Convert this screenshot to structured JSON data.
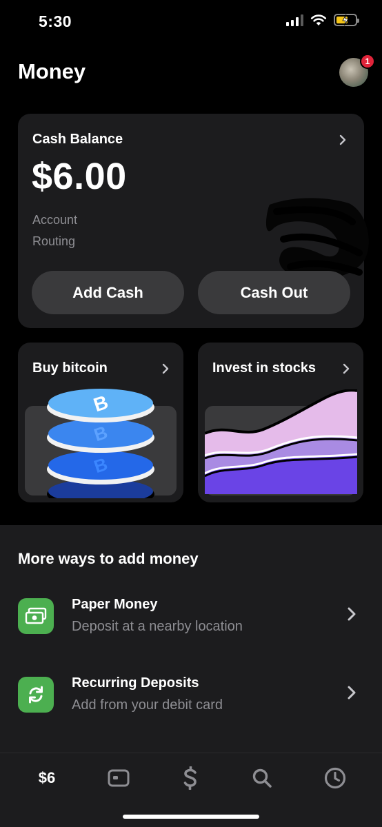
{
  "status_bar": {
    "time": "5:30",
    "signal_icon": "cellular-signal-icon",
    "wifi_icon": "wifi-icon",
    "battery_icon": "battery-charging-icon",
    "battery_color": "#f5c518"
  },
  "header": {
    "title": "Money",
    "avatar_icon": "profile-avatar",
    "notification_count": "1",
    "badge_color": "#e0243a"
  },
  "balance_card": {
    "label": "Cash Balance",
    "amount": "$6.00",
    "account_label": "Account",
    "routing_label": "Routing",
    "add_cash_label": "Add Cash",
    "cash_out_label": "Cash Out",
    "chevron_icon": "chevron-right-icon"
  },
  "bitcoin_card": {
    "title": "Buy bitcoin",
    "illustration": "bitcoin-coin-stack",
    "chevron_icon": "chevron-right-icon"
  },
  "stocks_card": {
    "title": "Invest in stocks",
    "illustration": "stock-waves",
    "chevron_icon": "chevron-right-icon"
  },
  "more_ways": {
    "title": "More ways to add money",
    "items": [
      {
        "title": "Paper Money",
        "subtitle": "Deposit at a nearby location",
        "icon": "banknote-icon"
      },
      {
        "title": "Recurring Deposits",
        "subtitle": "Add from your debit card",
        "icon": "recurring-arrows-icon"
      }
    ],
    "icon_color": "#4caf50"
  },
  "tab_bar": {
    "items": [
      {
        "label": "$6",
        "icon": "balance-tab"
      },
      {
        "icon": "card-icon"
      },
      {
        "icon": "dollar-sign-icon"
      },
      {
        "icon": "search-icon"
      },
      {
        "icon": "clock-icon"
      }
    ]
  },
  "colors": {
    "background": "#000000",
    "card": "#1c1c1e",
    "button": "#3a3a3c",
    "secondary_text": "#8e8e93"
  }
}
